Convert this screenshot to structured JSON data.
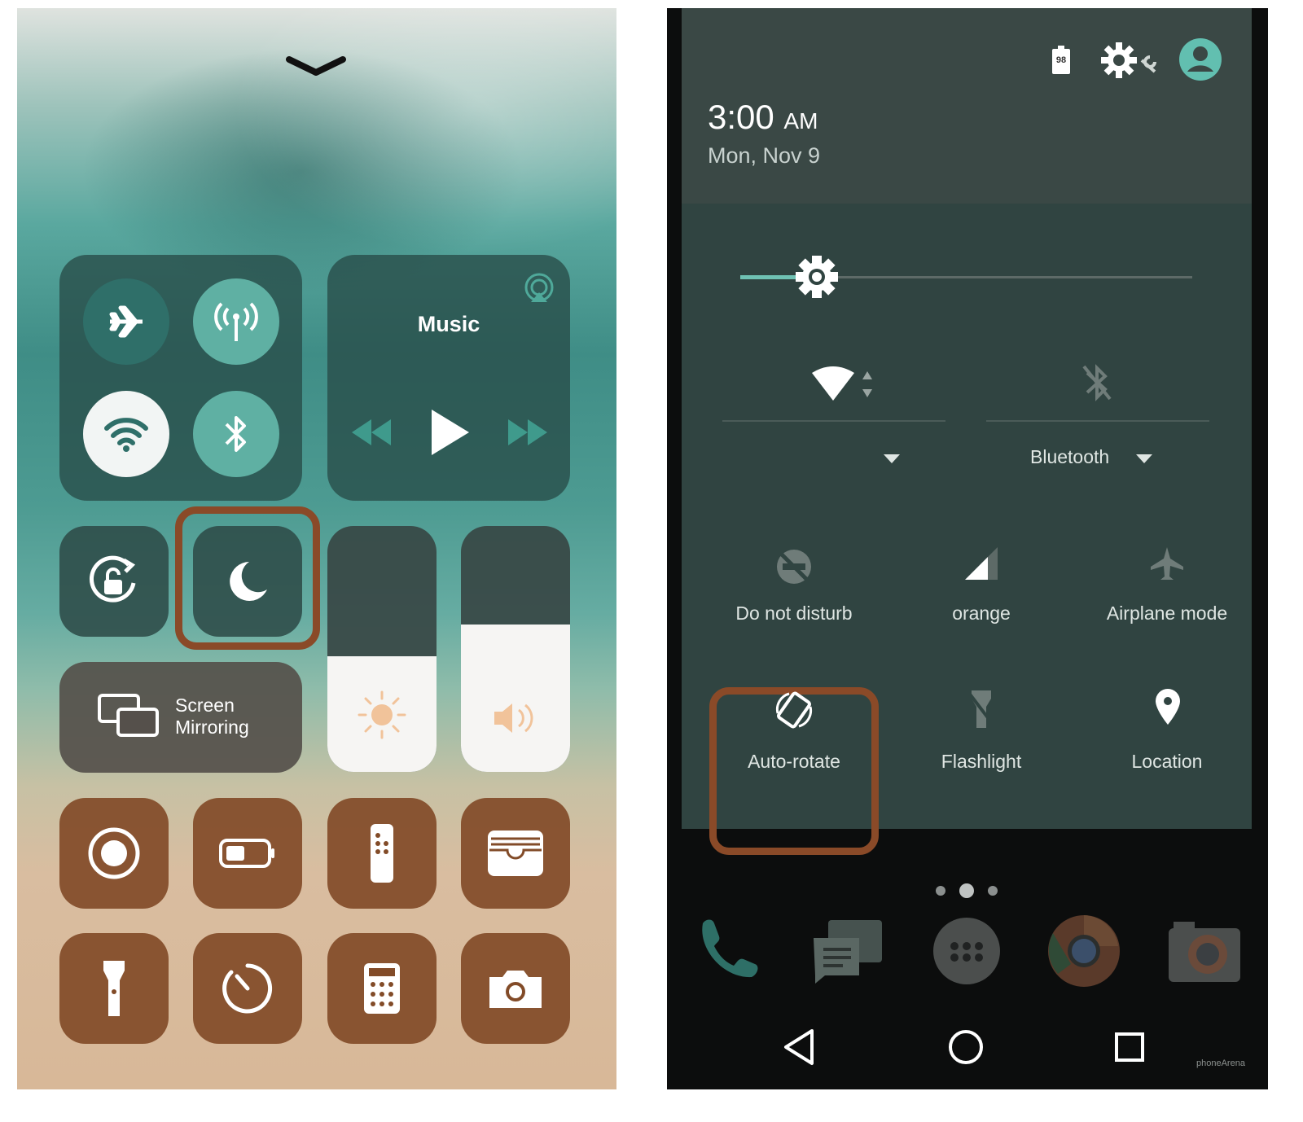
{
  "ios_control_center": {
    "music": {
      "title": "Music"
    },
    "screen_mirroring": {
      "line1": "Screen",
      "line2": "Mirroring"
    },
    "brightness_level": 0.47,
    "volume_level": 0.6,
    "do_not_disturb_highlight_color": "#8a4a28"
  },
  "android_quick_settings": {
    "status": {
      "battery_level": "98"
    },
    "header": {
      "time": "3:00",
      "ampm": "AM",
      "date": "Mon, Nov 9"
    },
    "brightness_level": 0.17,
    "wifi": {
      "label": ""
    },
    "bluetooth": {
      "label": "Bluetooth"
    },
    "tiles": {
      "do_not_disturb": "Do not disturb",
      "cellular": "orange",
      "airplane_mode": "Airplane mode",
      "auto_rotate": "Auto-rotate",
      "flashlight": "Flashlight",
      "location": "Location"
    },
    "watermark": "phoneArena"
  }
}
